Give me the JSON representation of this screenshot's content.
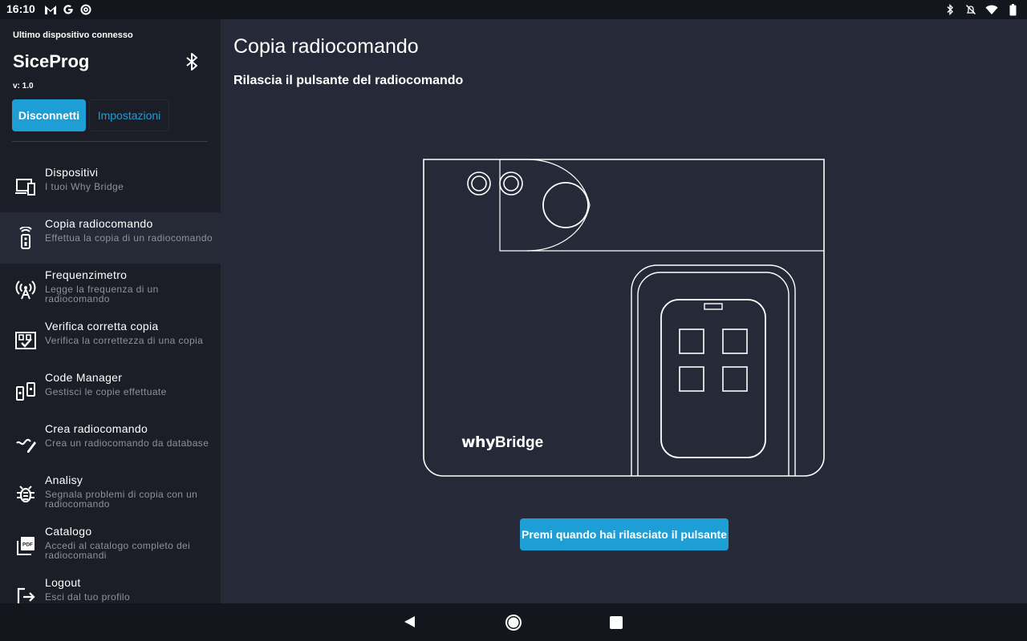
{
  "status_bar": {
    "time": "16:10",
    "left_icons": [
      "gmail-icon",
      "google-icon",
      "at-sign-icon"
    ],
    "right_icons": [
      "bluetooth-icon",
      "notifications-off-icon",
      "wifi-icon",
      "battery-icon"
    ]
  },
  "sidebar": {
    "caption": "Ultimo dispositivo connesso",
    "device_name": "SiceProg",
    "version": "v: 1.0",
    "disconnect_label": "Disconnetti",
    "settings_label": "Impostazioni",
    "items": [
      {
        "title": "Dispositivi",
        "subtitle": "I tuoi Why Bridge",
        "icon": "devices-icon"
      },
      {
        "title": "Copia radiocomando",
        "subtitle": "Effettua la copia di un radiocomando",
        "icon": "remote-control-icon"
      },
      {
        "title": "Frequenzimetro",
        "subtitle": "Legge la frequenza di un radiocomando",
        "icon": "antenna-icon"
      },
      {
        "title": "Verifica corretta copia",
        "subtitle": "Verifica la correttezza di una copia",
        "icon": "verify-copy-icon"
      },
      {
        "title": "Code Manager",
        "subtitle": "Gestisci le copie effettuate",
        "icon": "code-manager-icon"
      },
      {
        "title": "Crea radiocomando",
        "subtitle": "Crea un radiocomando da database",
        "icon": "create-remote-icon"
      },
      {
        "title": "Analisy",
        "subtitle": "Segnala problemi di copia con un radiocomando",
        "icon": "bug-icon"
      },
      {
        "title": "Catalogo",
        "subtitle": "Accedi al catalogo completo dei radiocomandi",
        "icon": "pdf-icon"
      },
      {
        "title": "Logout",
        "subtitle": "Esci dal tuo profilo",
        "icon": "logout-icon"
      }
    ]
  },
  "main": {
    "title": "Copia radiocomando",
    "subtitle": "Rilascia il pulsante del radiocomando",
    "brand_why": "why",
    "brand_bridge": "Bridge",
    "action_label": "Premi quando hai rilasciato il pulsante"
  }
}
